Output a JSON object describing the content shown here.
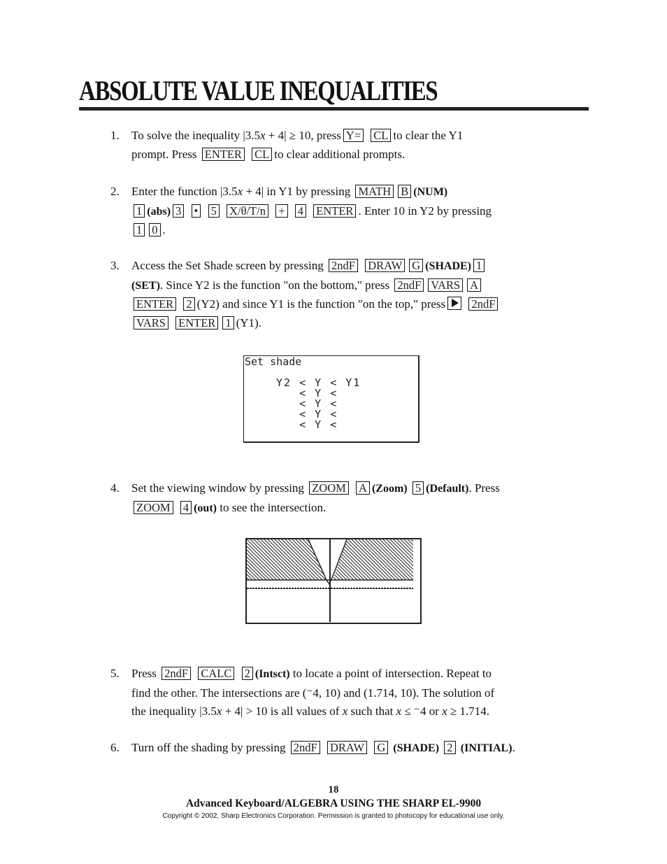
{
  "title": "ABSOLUTE VALUE INEQUALITIES",
  "steps": [
    {
      "num": "1.",
      "top": 0,
      "parts": [
        {
          "t": "t",
          "v": "To solve the inequality |3.5"
        },
        {
          "t": "i",
          "v": "x"
        },
        {
          "t": "t",
          "v": " + 4| ≥ 10, press"
        },
        {
          "t": "k",
          "v": "Y="
        },
        {
          "t": "t",
          "v": " "
        },
        {
          "t": "k",
          "v": "CL"
        },
        {
          "t": "t",
          "v": "to clear the Y1"
        },
        {
          "t": "br"
        },
        {
          "t": "t",
          "v": "prompt.  Press "
        },
        {
          "t": "k",
          "v": "ENTER"
        },
        {
          "t": "t",
          "v": " "
        },
        {
          "t": "k",
          "v": "CL"
        },
        {
          "t": "t",
          "v": "to clear additional prompts."
        }
      ]
    },
    {
      "num": "2.",
      "parts": [
        {
          "t": "t",
          "v": "Enter the function |3.5"
        },
        {
          "t": "i",
          "v": "x"
        },
        {
          "t": "t",
          "v": " + 4| in Y1 by pressing "
        },
        {
          "t": "k",
          "v": "MATH"
        },
        {
          "t": "k",
          "v": "B"
        },
        {
          "t": "b",
          "v": "(NUM)"
        },
        {
          "t": "br"
        },
        {
          "t": "k",
          "v": "1"
        },
        {
          "t": "b",
          "v": "(abs)"
        },
        {
          "t": "k",
          "v": "3"
        },
        {
          "t": "t",
          "v": " "
        },
        {
          "t": "k",
          "v": "•"
        },
        {
          "t": "t",
          "v": " "
        },
        {
          "t": "k",
          "v": "5"
        },
        {
          "t": "t",
          "v": " "
        },
        {
          "t": "k",
          "v": "X/θ/T/n"
        },
        {
          "t": "t",
          "v": " "
        },
        {
          "t": "k",
          "v": "+"
        },
        {
          "t": "t",
          "v": " "
        },
        {
          "t": "k",
          "v": "4"
        },
        {
          "t": "t",
          "v": " "
        },
        {
          "t": "k",
          "v": "ENTER"
        },
        {
          "t": "t",
          "v": ".  Enter 10 in Y2 by pressing"
        },
        {
          "t": "br"
        },
        {
          "t": "k",
          "v": "1"
        },
        {
          "t": "k",
          "v": "0"
        },
        {
          "t": "t",
          "v": "."
        }
      ]
    },
    {
      "num": "3.",
      "parts": [
        {
          "t": "t",
          "v": "Access the Set Shade screen by pressing "
        },
        {
          "t": "k",
          "v": "2ndF"
        },
        {
          "t": "t",
          "v": " "
        },
        {
          "t": "k",
          "v": "DRAW"
        },
        {
          "t": "k",
          "v": "G"
        },
        {
          "t": "b",
          "v": "(SHADE)"
        },
        {
          "t": "k",
          "v": "1"
        },
        {
          "t": "br"
        },
        {
          "t": "b",
          "v": "(SET)"
        },
        {
          "t": "t",
          "v": ".  Since Y2 is the function \"on the bottom,\" press "
        },
        {
          "t": "k",
          "v": "2ndF"
        },
        {
          "t": "k",
          "v": "VARS"
        },
        {
          "t": "k",
          "v": "A"
        },
        {
          "t": "br"
        },
        {
          "t": "k",
          "v": "ENTER"
        },
        {
          "t": "t",
          "v": " "
        },
        {
          "t": "k",
          "v": "2"
        },
        {
          "t": "t",
          "v": "(Y2) and since Y1 is the function \"on the top,\" press"
        },
        {
          "t": "p",
          "v": "right-arrow-key"
        },
        {
          "t": "t",
          "v": " "
        },
        {
          "t": "k",
          "v": "2ndF"
        },
        {
          "t": "br"
        },
        {
          "t": "k",
          "v": "VARS"
        },
        {
          "t": "t",
          "v": " "
        },
        {
          "t": "k",
          "v": "ENTER"
        },
        {
          "t": "k",
          "v": "1"
        },
        {
          "t": "t",
          "v": "(Y1)."
        }
      ]
    },
    {
      "num": "4.",
      "parts": [
        {
          "t": "t",
          "v": "Set the viewing window by pressing "
        },
        {
          "t": "k",
          "v": "ZOOM"
        },
        {
          "t": "t",
          "v": " "
        },
        {
          "t": "k",
          "v": "A"
        },
        {
          "t": "b",
          "v": "(Zoom)"
        },
        {
          "t": "t",
          "v": " "
        },
        {
          "t": "k",
          "v": "5"
        },
        {
          "t": "b",
          "v": "(Default)"
        },
        {
          "t": "t",
          "v": ".  Press"
        },
        {
          "t": "br"
        },
        {
          "t": "k",
          "v": "ZOOM"
        },
        {
          "t": "t",
          "v": " "
        },
        {
          "t": "k",
          "v": "4"
        },
        {
          "t": "b",
          "v": "(out)"
        },
        {
          "t": "t",
          "v": " to see the intersection."
        }
      ]
    },
    {
      "num": "5.",
      "parts": [
        {
          "t": "t",
          "v": "Press "
        },
        {
          "t": "k",
          "v": "2ndF"
        },
        {
          "t": "t",
          "v": " "
        },
        {
          "t": "k",
          "v": "CALC"
        },
        {
          "t": "t",
          "v": " "
        },
        {
          "t": "k",
          "v": "2"
        },
        {
          "t": "b",
          "v": "(Intsct)"
        },
        {
          "t": "t",
          "v": " to locate a point of intersection.  Repeat to"
        },
        {
          "t": "br"
        },
        {
          "t": "t",
          "v": "find the other.  The intersections are (⁻4, 10) and (1.714, 10).  The solution of"
        },
        {
          "t": "br"
        },
        {
          "t": "t",
          "v": "the inequality |3.5"
        },
        {
          "t": "i",
          "v": "x"
        },
        {
          "t": "t",
          "v": " + 4| > 10 is all values of "
        },
        {
          "t": "i",
          "v": "x"
        },
        {
          "t": "t",
          "v": " such that "
        },
        {
          "t": "i",
          "v": "x"
        },
        {
          "t": "t",
          "v": " ≤ ⁻4 or "
        },
        {
          "t": "i",
          "v": "x"
        },
        {
          "t": "t",
          "v": " ≥ 1.714."
        }
      ]
    },
    {
      "num": "6.",
      "parts": [
        {
          "t": "t",
          "v": "Turn off the shading by pressing "
        },
        {
          "t": "k",
          "v": "2ndF"
        },
        {
          "t": "t",
          "v": " "
        },
        {
          "t": "k",
          "v": "DRAW"
        },
        {
          "t": "t",
          "v": " "
        },
        {
          "t": "k",
          "v": "G"
        },
        {
          "t": "b",
          "v": " (SHADE)"
        },
        {
          "t": "t",
          "v": " "
        },
        {
          "t": "k",
          "v": "2"
        },
        {
          "t": "t",
          "v": " "
        },
        {
          "t": "b",
          "v": "(INITIAL)"
        },
        {
          "t": "t",
          "v": "."
        }
      ]
    }
  ],
  "set_shade_screen": {
    "heading": "Set shade",
    "rows": [
      "Y2 < Y < Y1",
      "   < Y <",
      "   < Y <",
      "   < Y <",
      "   < Y <"
    ]
  },
  "graph_screen": {
    "shading": "between Y2 and Y1"
  },
  "footer": {
    "page_number": "18",
    "book_title": "Advanced Keyboard/ALGEBRA USING THE SHARP EL-9900",
    "copyright": "Copyright © 2002, Sharp Electronics Corporation.  Permission is granted to photocopy for educational use only."
  }
}
